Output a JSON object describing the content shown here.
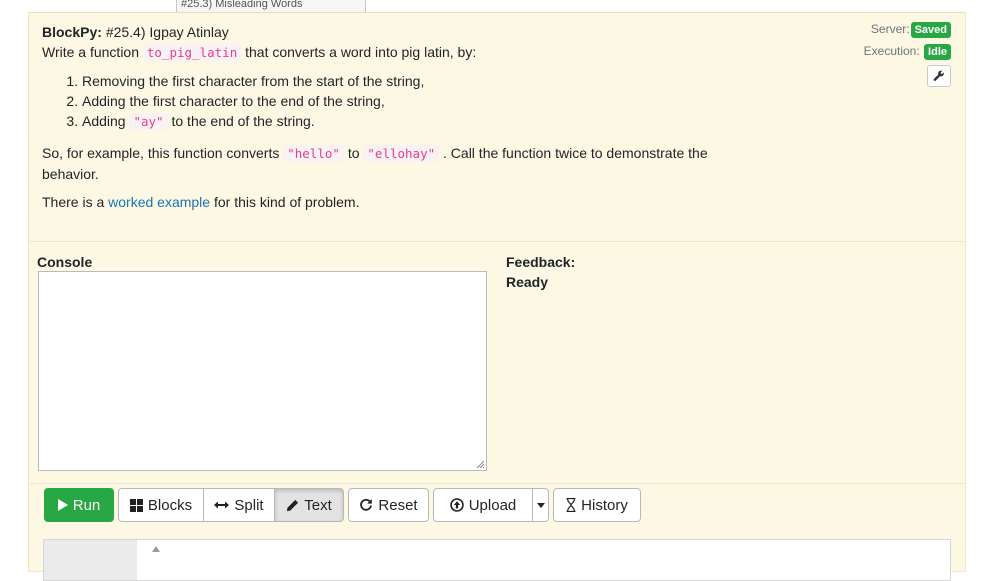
{
  "top_dropdown": {
    "label": "#25.3) Misleading Words"
  },
  "header": {
    "app_name": "BlockPy:",
    "assignment_title": "#25.4) Igpay Atinlay",
    "server_label": "Server:",
    "server_status": "Saved",
    "execution_label": "Execution:",
    "execution_status": "Idle",
    "status_color": "#28a745"
  },
  "instructions": {
    "intro_before": "Write a function",
    "function_name": "to_pig_latin",
    "intro_after": "that converts a word into pig latin, by:",
    "steps": [
      {
        "text": "Removing the first character from the start of the string,"
      },
      {
        "text": "Adding the first character to the end of the string,"
      },
      {
        "before": "Adding",
        "code": "\"ay\"",
        "after": "to the end of the string."
      }
    ],
    "example_before": "So, for example, this function converts",
    "example_input": "\"hello\"",
    "example_to": "to",
    "example_output": "\"ellohay\"",
    "example_after": ". Call the function twice to demonstrate the behavior.",
    "worked_before": "There is a",
    "worked_link": "worked example",
    "worked_after": "for this kind of problem."
  },
  "console": {
    "label": "Console"
  },
  "feedback": {
    "label": "Feedback:",
    "status": "Ready"
  },
  "toolbar": {
    "run": "Run",
    "blocks": "Blocks",
    "split": "Split",
    "text": "Text",
    "reset": "Reset",
    "upload": "Upload",
    "history": "History"
  }
}
